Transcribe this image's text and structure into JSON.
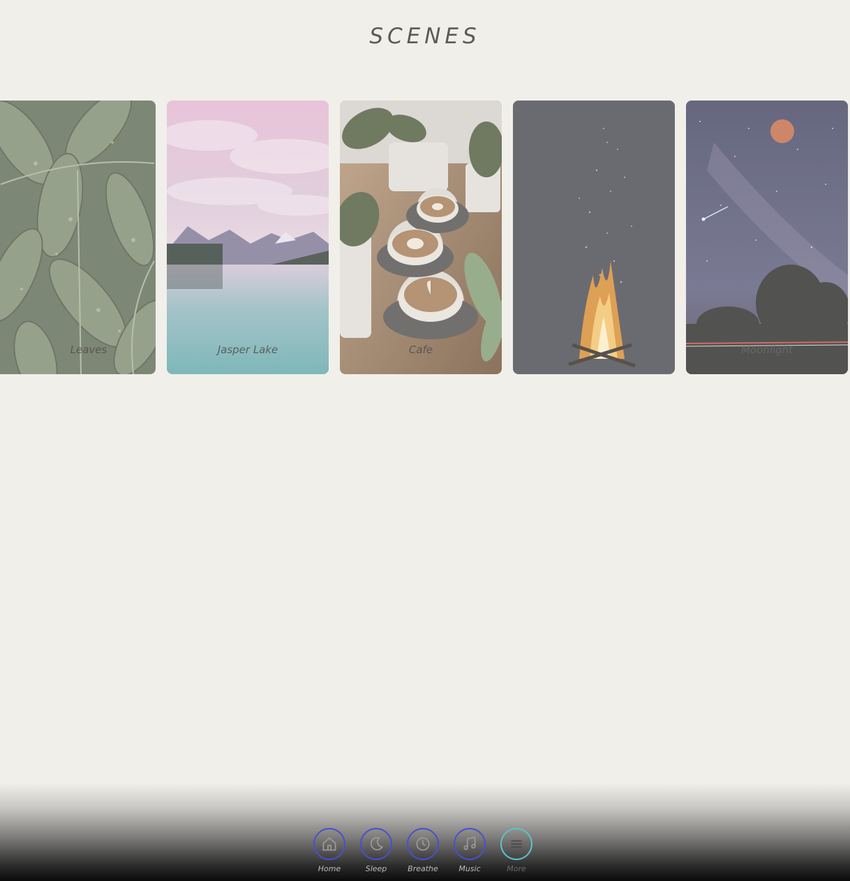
{
  "page": {
    "title": "SCENES"
  },
  "scenes": [
    {
      "label": "Leaves"
    },
    {
      "label": "Jasper Lake"
    },
    {
      "label": "Cafe"
    },
    {
      "label": ""
    },
    {
      "label": "Moonlight"
    }
  ],
  "nav": {
    "items": [
      {
        "label": "Home",
        "icon": "home-icon"
      },
      {
        "label": "Sleep",
        "icon": "moon-icon"
      },
      {
        "label": "Breathe",
        "icon": "clock-icon"
      },
      {
        "label": "Music",
        "icon": "music-note-icon"
      },
      {
        "label": "More",
        "icon": "menu-icon"
      }
    ],
    "accent": "#4a4fd0",
    "more_accent": "#5cc2c9"
  },
  "colors": {
    "background": "#f1efea",
    "title": "#5b5a57"
  }
}
